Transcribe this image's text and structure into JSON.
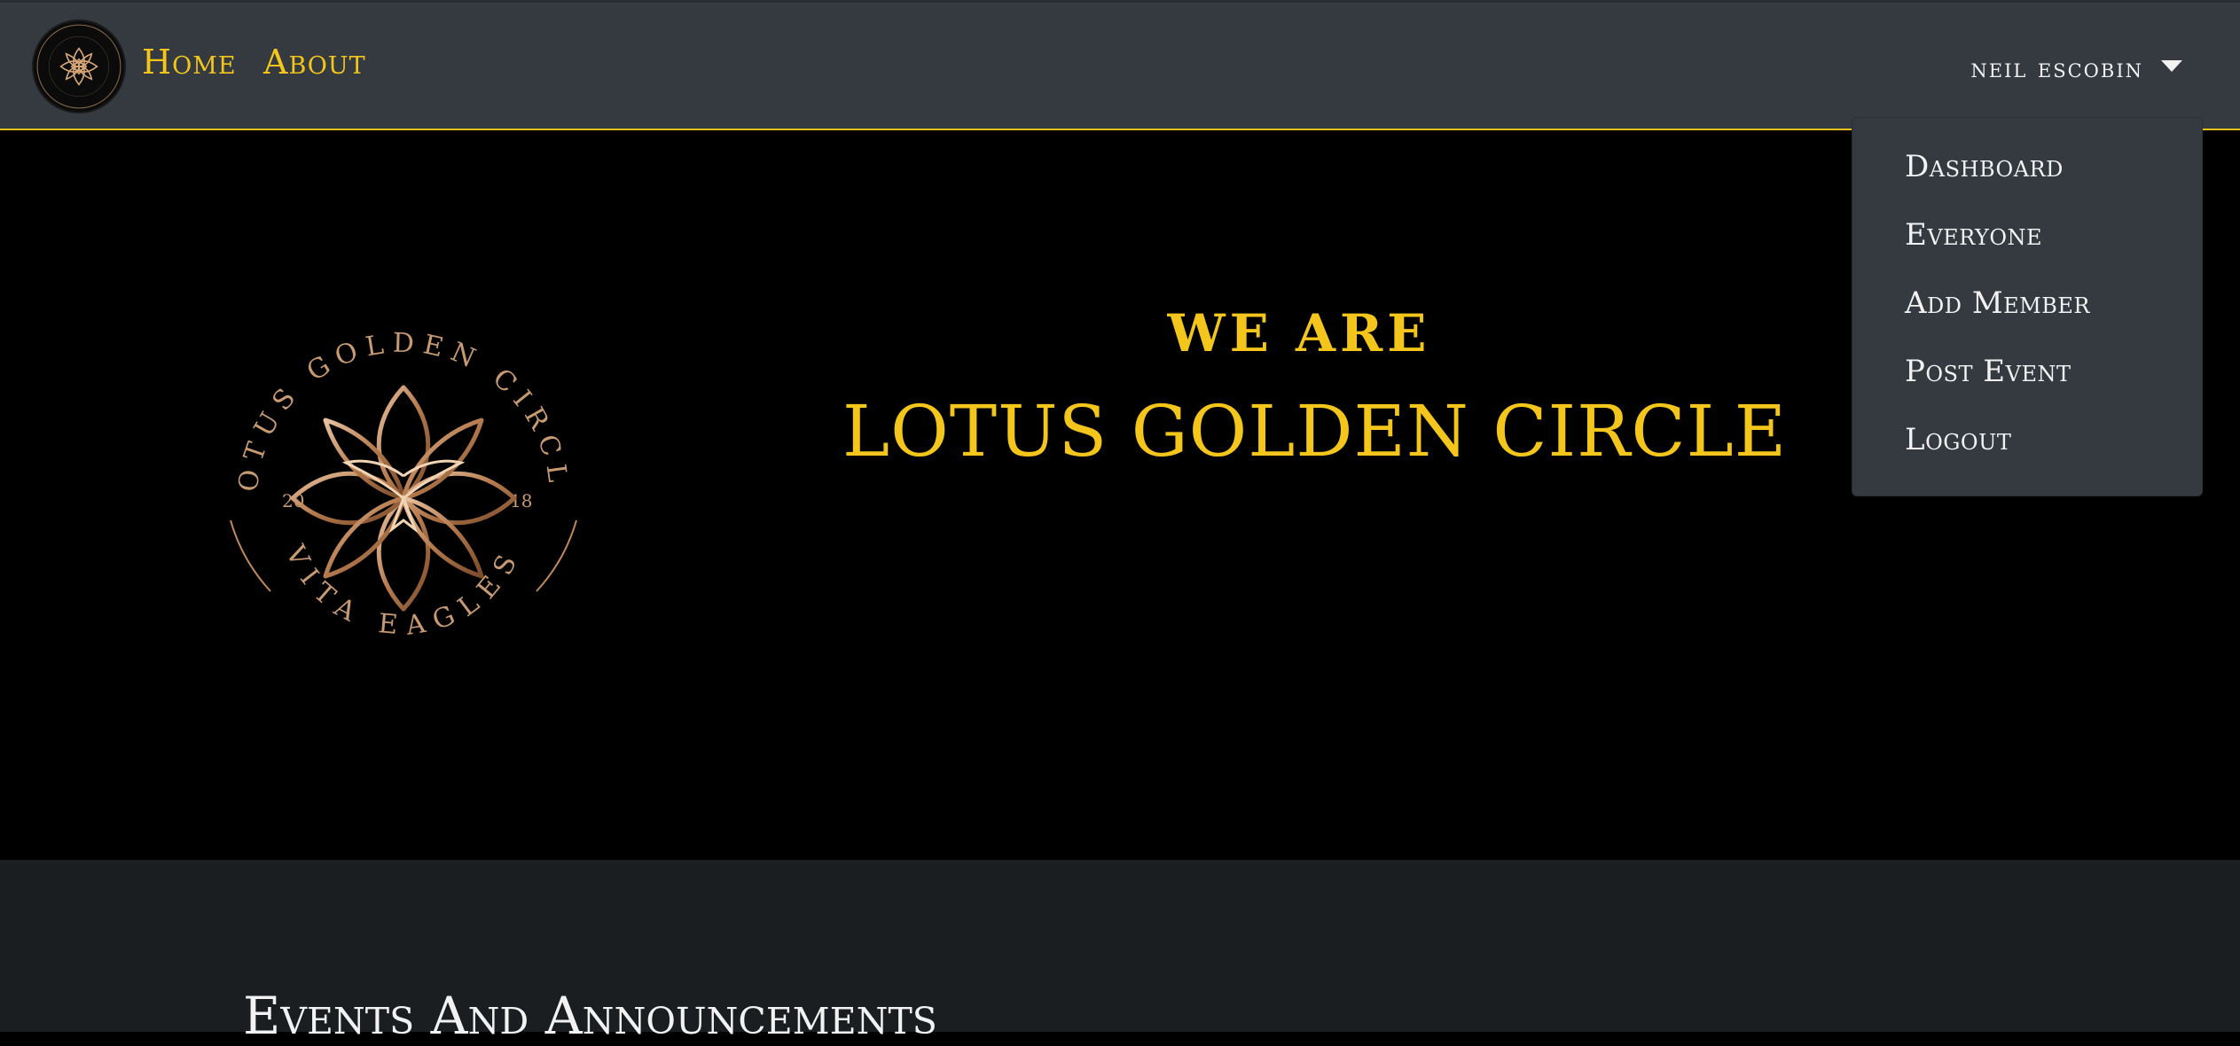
{
  "nav": {
    "home": "Home",
    "about": "About"
  },
  "user": {
    "name": "neil escobin"
  },
  "dropdown": {
    "items": [
      "Dashboard",
      "Everyone",
      "Add Member",
      "Post Event",
      "Logout"
    ]
  },
  "hero": {
    "kicker": "WE ARE",
    "title": "LOTUS GOLDEN CIRCLE"
  },
  "emblem": {
    "top_text": "LOTUS GOLDEN CIRCLE",
    "bottom_text": "VITA EAGLES",
    "year_left": "20",
    "year_right": "18"
  },
  "events": {
    "heading": "Events And Announcements"
  },
  "colors": {
    "accent_gold": "#f4c61c",
    "navbar_bg": "#343a40",
    "hero_bg": "#000000",
    "section_bg": "#1b1e21",
    "emblem_bronze": "#c08a5a"
  },
  "icons": {
    "brand": "lotus-logo-icon",
    "caret": "caret-down-icon"
  }
}
